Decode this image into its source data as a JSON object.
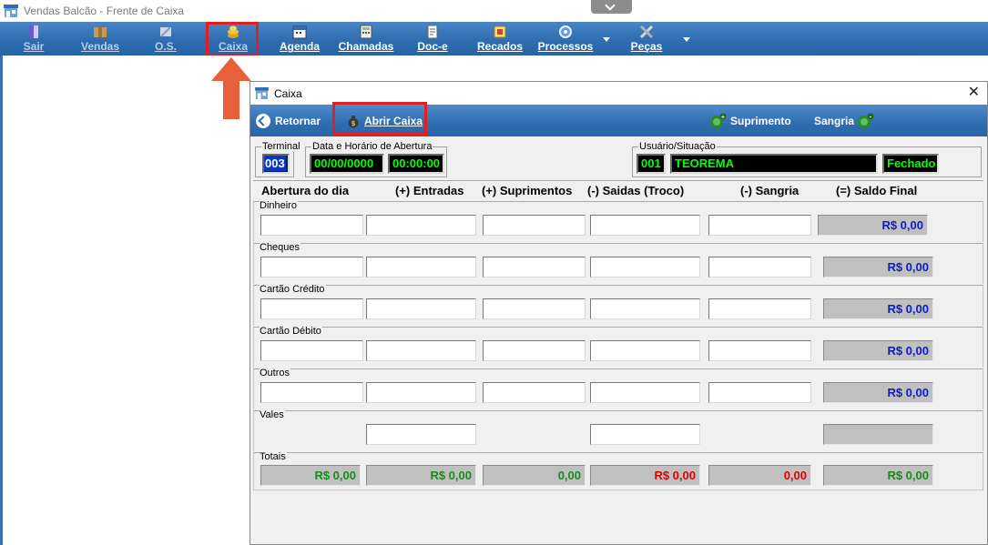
{
  "window": {
    "title": "Vendas Balcão - Frente de Caixa"
  },
  "toolbar": {
    "items": [
      {
        "label": "Sair",
        "icon": "door-icon"
      },
      {
        "label": "Vendas",
        "icon": "box-icon"
      },
      {
        "label": "O.S.",
        "icon": "wrench-icon"
      },
      {
        "label": "Caixa",
        "icon": "coins-icon"
      },
      {
        "label": "Agenda",
        "icon": "calendar-icon"
      },
      {
        "label": "Chamadas",
        "icon": "calculator-icon"
      },
      {
        "label": "Doc-e",
        "icon": "document-icon"
      },
      {
        "label": "Recados",
        "icon": "notes-icon"
      },
      {
        "label": "Processos",
        "icon": "gear-icon"
      },
      {
        "label": "Peças",
        "icon": "tools-icon"
      }
    ]
  },
  "dialog": {
    "title": "Caixa",
    "close_glyph": "✕",
    "toolbar": {
      "retornar": "Retornar",
      "abrir_caixa": "Abrir Caixa",
      "suprimento": "Suprimento",
      "sangria": "Sangria"
    },
    "terminal": {
      "label": "Terminal",
      "value": "003"
    },
    "abertura": {
      "label": "Data e Horário de Abertura",
      "date": "00/00/0000",
      "time": "00:00:00"
    },
    "usuario": {
      "label": "Usuário/Situação",
      "code": "001",
      "name": "TEOREMA",
      "status": "Fechado"
    },
    "columns": [
      "Abertura do dia",
      "(+) Entradas",
      "(+) Suprimentos",
      "(-) Saidas (Troco)",
      "(-) Sangria",
      "(=) Saldo Final"
    ],
    "rows": [
      {
        "label": "Dinheiro",
        "saldo": "R$ 0,00"
      },
      {
        "label": "Cheques",
        "saldo": "R$ 0,00"
      },
      {
        "label": "Cartão Crédito",
        "saldo": "R$ 0,00"
      },
      {
        "label": "Cartão Débito",
        "saldo": "R$ 0,00"
      },
      {
        "label": "Outros",
        "saldo": "R$ 0,00"
      },
      {
        "label": "Vales",
        "saldo": ""
      }
    ],
    "totais": {
      "label": "Totais",
      "values": [
        "R$ 0,00",
        "R$ 0,00",
        "0,00",
        "R$ 0,00",
        "0,00",
        "R$ 0,00"
      ]
    }
  },
  "colors": {
    "toolbar_blue": "#2f6db0",
    "highlight_red": "#e02020",
    "arrow_orange": "#e8603a",
    "saldo_blue": "#0a1ec8",
    "totals_green": "#1a8a1a",
    "totals_red": "#e00000",
    "field_green": "#00ff00"
  }
}
